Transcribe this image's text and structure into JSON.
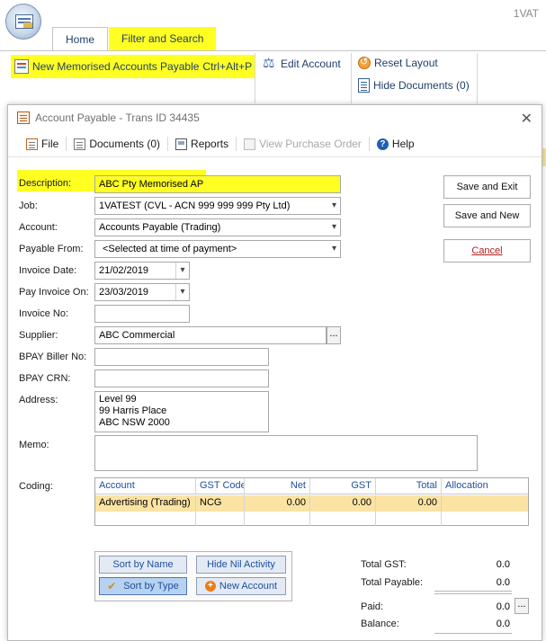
{
  "app": {
    "title_partial": "1VAT",
    "tabs": [
      {
        "label": "Home"
      },
      {
        "label": "Filter and Search"
      }
    ],
    "ribbon": {
      "new_memorised": "New Memorised Accounts Payable",
      "new_memorised_shortcut": "Ctrl+Alt+P",
      "edit_account": "Edit Account",
      "reset_layout": "Reset Layout",
      "hide_documents": "Hide Documents (0)"
    }
  },
  "dialog": {
    "title": "Account Payable - Trans ID 34435",
    "toolbar": {
      "file": "File",
      "documents": "Documents (0)",
      "reports": "Reports",
      "view_po": "View Purchase Order",
      "help": "Help"
    },
    "labels": {
      "description": "Description:",
      "job": "Job:",
      "account": "Account:",
      "payable_from": "Payable From:",
      "invoice_date": "Invoice Date:",
      "pay_invoice_on": "Pay Invoice On:",
      "invoice_no": "Invoice No:",
      "supplier": "Supplier:",
      "bpay_biller": "BPAY Biller No:",
      "bpay_crn": "BPAY CRN:",
      "address": "Address:",
      "memo": "Memo:",
      "coding": "Coding:"
    },
    "values": {
      "description": "ABC Pty Memorised AP",
      "job": "1VATEST (CVL - ACN 999 999 999 Pty Ltd)",
      "account": "Accounts Payable (Trading)",
      "payable_from": "<Selected at time of payment>",
      "invoice_date": "21/02/2019",
      "pay_invoice_on": "23/03/2019",
      "invoice_no": "",
      "supplier": "ABC Commercial",
      "bpay_biller": "",
      "bpay_crn": "",
      "address_line1": "Level 99",
      "address_line2": "99 Harris Place",
      "address_line3": "ABC NSW 2000",
      "memo": ""
    },
    "buttons": {
      "save_exit": "Save and Exit",
      "save_new": "Save and New",
      "cancel": "Cancel",
      "ellipsis": "..."
    },
    "coding": {
      "headers": [
        "Account",
        "GST Code",
        "Net",
        "GST",
        "Total",
        "Allocation"
      ],
      "rows": [
        [
          "Advertising (Trading)",
          "NCG",
          "0.00",
          "0.00",
          "0.00",
          ""
        ]
      ]
    },
    "sort_panel": {
      "sort_by_name": "Sort by Name",
      "hide_nil": "Hide Nil Activity",
      "sort_by_type": "Sort by Type",
      "new_account": "New Account"
    },
    "totals": {
      "total_gst_label": "Total GST:",
      "total_gst": "0.0",
      "total_payable_label": "Total Payable:",
      "total_payable": "0.0",
      "paid_label": "Paid:",
      "paid": "0.0",
      "balance_label": "Balance:",
      "balance": "0.0"
    },
    "highlight_color": "#ffff22",
    "row_highlight_color": "#fbe3a4"
  }
}
